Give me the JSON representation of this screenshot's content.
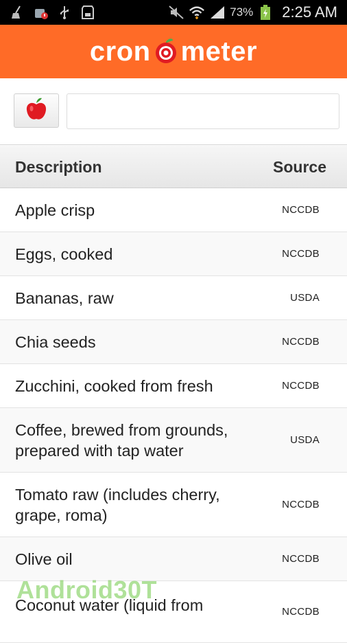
{
  "status_bar": {
    "battery_percent": "73%",
    "time": "2:25 AM"
  },
  "header": {
    "logo_left": "cron",
    "logo_right": "meter"
  },
  "search": {
    "value": "",
    "placeholder": ""
  },
  "table": {
    "columns": {
      "description": "Description",
      "source": "Source"
    },
    "rows": [
      {
        "description": "Apple crisp",
        "source": "NCCDB"
      },
      {
        "description": "Eggs, cooked",
        "source": "NCCDB"
      },
      {
        "description": "Bananas, raw",
        "source": "USDA"
      },
      {
        "description": "Chia seeds",
        "source": "NCCDB"
      },
      {
        "description": "Zucchini, cooked from fresh",
        "source": "NCCDB"
      },
      {
        "description": "Coffee, brewed from grounds, prepared with tap water",
        "source": "USDA"
      },
      {
        "description": "Tomato raw (includes cherry, grape, roma)",
        "source": "NCCDB"
      },
      {
        "description": "Olive oil",
        "source": "NCCDB"
      },
      {
        "description": "Coconut water (liquid from",
        "source": "NCCDB"
      }
    ]
  },
  "watermark": "Android30T",
  "colors": {
    "brand_orange": "#ff6b27",
    "apple_red": "#e01b22",
    "leaf_green": "#4caf50"
  },
  "icons": {
    "food_button": "apple-icon",
    "status": [
      "broom-icon",
      "alert-bag-icon",
      "usb-icon",
      "sd-card-icon",
      "mute-icon",
      "wifi-icon",
      "signal-icon",
      "battery-charging-icon"
    ]
  }
}
